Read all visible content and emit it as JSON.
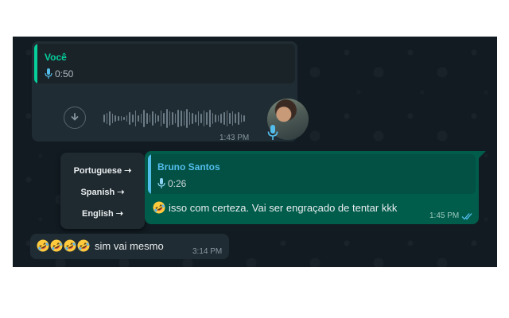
{
  "colors": {
    "chat_bg": "#111b21",
    "incoming_bubble": "#202c33",
    "outgoing_bubble": "#005c4b",
    "author_incoming": "#06cf9c",
    "author_outgoing": "#53bdeb",
    "read_ticks": "#53bdeb"
  },
  "voice_message": {
    "quote_author": "Você",
    "quote_duration": "0:50",
    "time": "1:43 PM",
    "icons": [
      "mic-icon",
      "download-icon",
      "waveform",
      "avatar",
      "mic-icon"
    ]
  },
  "outgoing_message": {
    "quote_author": "Bruno Santos",
    "quote_duration": "0:26",
    "emoji": "rolling-on-floor-laughing",
    "text": "isso com certeza. Vai ser engraçado de tentar kkk",
    "time": "1:45 PM",
    "status_icon": "double-check-read-icon"
  },
  "translate_menu": {
    "items": [
      {
        "label": "Portuguese ➝"
      },
      {
        "label": "Spanish ➝"
      },
      {
        "label": "English ➝"
      }
    ]
  },
  "emoji_message": {
    "emoji_count": 4,
    "emoji": "rolling-on-floor-laughing",
    "text": "sim vai mesmo",
    "time": "3:14 PM"
  }
}
